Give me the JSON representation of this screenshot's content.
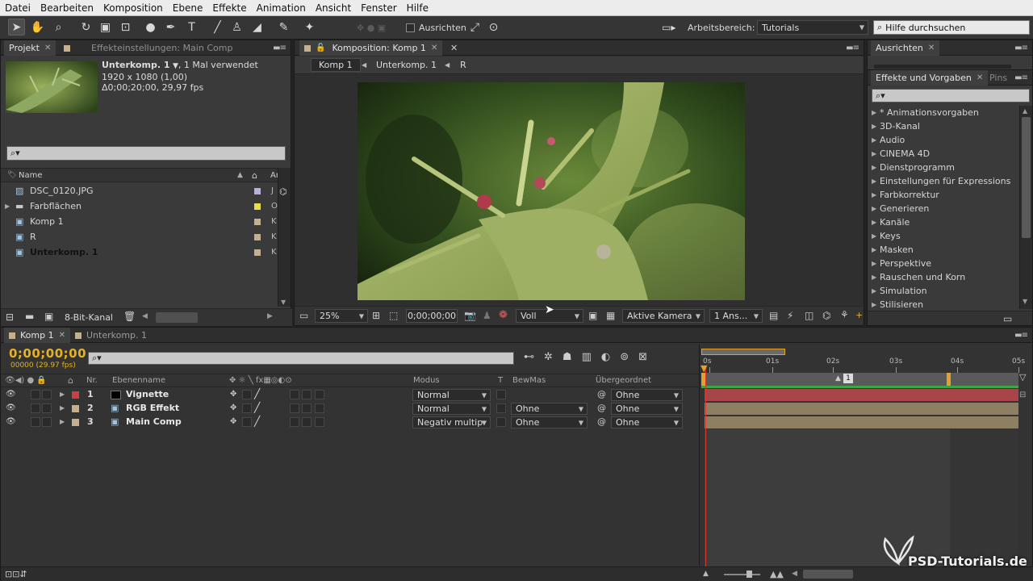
{
  "menu": [
    "Datei",
    "Bearbeiten",
    "Komposition",
    "Ebene",
    "Effekte",
    "Animation",
    "Ansicht",
    "Fenster",
    "Hilfe"
  ],
  "toolbar": {
    "ausrichten_label": "Ausrichten",
    "workspace_label": "Arbeitsbereich:",
    "workspace_value": "Tutorials",
    "help_placeholder": "Hilfe durchsuchen"
  },
  "project": {
    "tab_project": "Projekt",
    "tab_effects": "Effekteinstellungen: Main Comp",
    "selected_name": "Unterkomp. 1",
    "selected_usage": ", 1 Mal verwendet",
    "selected_dims": "1920 x 1080 (1,00)",
    "selected_duration": "Δ0;00;20;00, 29,97 fps",
    "search_symbol": "⌕▾",
    "col_name": "Name",
    "col_type": "Art",
    "items": [
      {
        "name": "DSC_0120.JPG",
        "type": "J",
        "color": "#b7b0d8",
        "icon": "image-icon"
      },
      {
        "name": "Farbflächen",
        "type": "O",
        "color": "#e4e24a",
        "icon": "folder-icon"
      },
      {
        "name": "Komp 1",
        "type": "K",
        "color": "#c4b08a",
        "icon": "composition-icon"
      },
      {
        "name": "R",
        "type": "K",
        "color": "#c4b08a",
        "icon": "composition-icon"
      },
      {
        "name": "Unterkomp. 1",
        "type": "K",
        "color": "#c4b08a",
        "icon": "composition-icon"
      }
    ],
    "bitdepth": "8-Bit-Kanal"
  },
  "composition": {
    "tab": "Komposition: Komp 1",
    "breadcrumb": [
      "Komp 1",
      "Unterkomp. 1",
      "R"
    ],
    "zoom": "25%",
    "timecode": "0;00;00;00",
    "resolution": "Voll",
    "camera": "Aktive Kamera",
    "views": "1 Ans..."
  },
  "right": {
    "tab_align": "Ausrichten",
    "tab_effects": "Effekte und Vorgaben",
    "tab_pins": "Pins",
    "search_symbol": "⌕▾",
    "effects": [
      "* Animationsvorgaben",
      "3D-Kanal",
      "Audio",
      "CINEMA 4D",
      "Dienstprogramm",
      "Einstellungen für Expressions",
      "Farbkorrektur",
      "Generieren",
      "Kanäle",
      "Keys",
      "Masken",
      "Perspektive",
      "Rauschen und Korn",
      "Simulation",
      "Stilisieren"
    ]
  },
  "timeline": {
    "tab_comp": "Komp 1",
    "tab_sub": "Unterkomp. 1",
    "timecode": "0;00;00;00",
    "fps": "00000 (29.97 fps)",
    "search_symbol": "⌕▾",
    "col_nr": "Nr.",
    "col_name": "Ebenenname",
    "col_mode": "Modus",
    "col_t": "T",
    "col_trkmat": "BewMas",
    "col_parent": "Übergeordnet",
    "ruler": [
      "0s",
      "01s",
      "02s",
      "03s",
      "04s",
      "05s"
    ],
    "marker": "1",
    "layers": [
      {
        "nr": "1",
        "name": "Vignette",
        "mode": "Normal",
        "trkmat": "",
        "parent": "Ohne",
        "label_color": "#c8403f",
        "bar_color": "#a84548"
      },
      {
        "nr": "2",
        "name": "RGB Effekt",
        "mode": "Normal",
        "trkmat": "Ohne",
        "parent": "Ohne",
        "label_color": "#c4b08a",
        "bar_color": "#8f7f62"
      },
      {
        "nr": "3",
        "name": "Main Comp",
        "mode": "Negativ multip",
        "trkmat": "Ohne",
        "parent": "Ohne",
        "label_color": "#c4b08a",
        "bar_color": "#8f7f62"
      }
    ]
  },
  "watermark": "PSD-Tutorials.de"
}
